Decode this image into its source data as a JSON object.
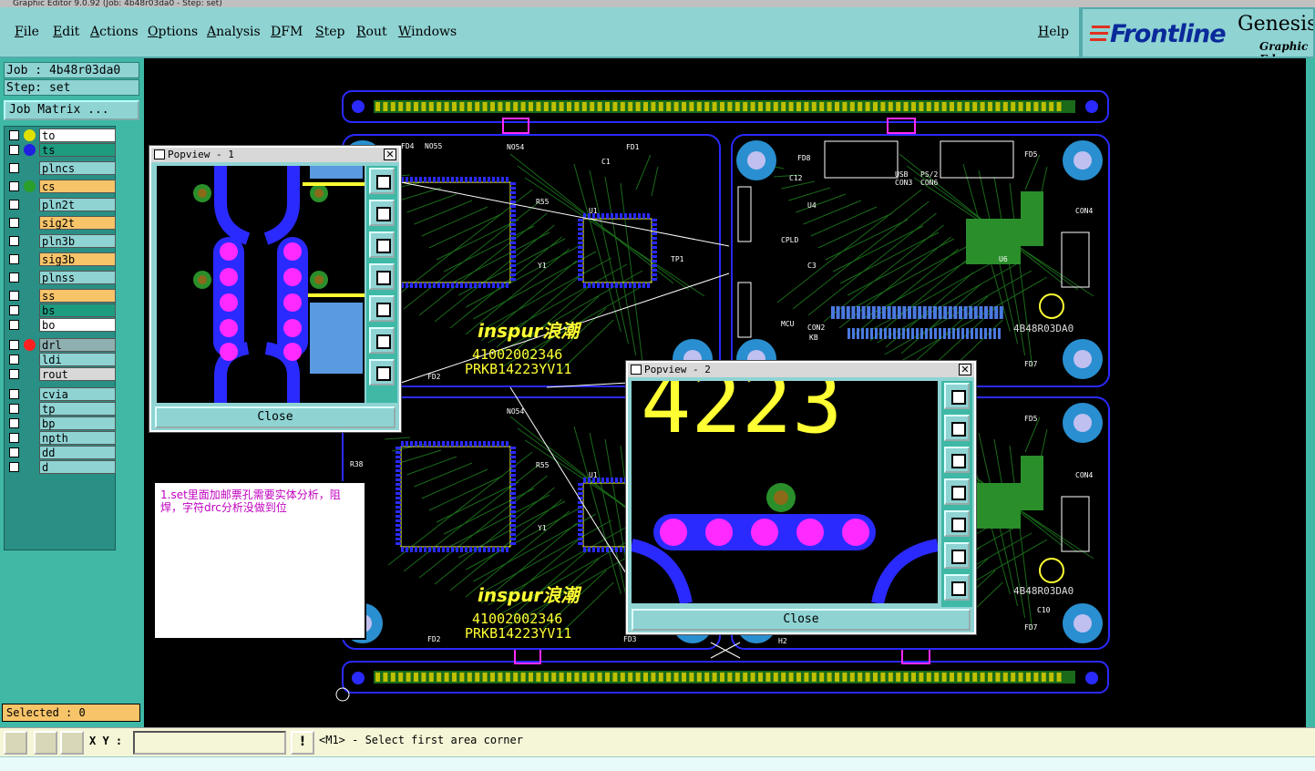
{
  "window": {
    "title": "Graphic Editor 9.0.92 (Job: 4b48r03da0 - Step: set)"
  },
  "menu": [
    "File",
    "Edit",
    "Actions",
    "Options",
    "Analysis",
    "DFM",
    "Step",
    "Rout",
    "Windows"
  ],
  "help": "Help",
  "logo": {
    "brand": "Frontline",
    "product": "Genesis",
    "subtitle": "Graphic Ed"
  },
  "job": {
    "label": "Job : 4b48r03da0",
    "step": "Step: set",
    "matrix_button": "Job Matrix ..."
  },
  "layers": [
    {
      "name": "to",
      "color": "#ffff00",
      "bg": "#ffffff",
      "dot": "#e0e000"
    },
    {
      "name": "ts",
      "color": "#1a1aff",
      "bg": "#1d9c80",
      "dot": "#2020e0"
    },
    {
      "name": "plncs",
      "bg": "#8fd3d3"
    },
    {
      "name": "cs",
      "bg": "#f7c46a",
      "dot": "#2aa02a"
    },
    {
      "name": "pln2t",
      "bg": "#8fd3d3"
    },
    {
      "name": "sig2t",
      "bg": "#f7c46a"
    },
    {
      "name": "pln3b",
      "bg": "#8fd3d3"
    },
    {
      "name": "sig3b",
      "bg": "#f7c46a"
    },
    {
      "name": "plnss",
      "bg": "#8fd3d3"
    },
    {
      "name": "ss",
      "bg": "#f7c46a"
    },
    {
      "name": "bs",
      "bg": "#1d9c80"
    },
    {
      "name": "bo",
      "bg": "#ffffff"
    },
    {
      "name": "drl",
      "bg": "#8fb0b0",
      "dot": "#ff2020"
    },
    {
      "name": "ldi",
      "bg": "#8fd3d3"
    },
    {
      "name": "rout",
      "bg": "#d8d8d8"
    },
    {
      "name": "cvia",
      "bg": "#8fd3d3"
    },
    {
      "name": "tp",
      "bg": "#8fd3d3"
    },
    {
      "name": "bp",
      "bg": "#8fd3d3"
    },
    {
      "name": "npth",
      "bg": "#8fd3d3"
    },
    {
      "name": "dd",
      "bg": "#8fd3d3"
    },
    {
      "name": "d",
      "bg": "#8fd3d3"
    }
  ],
  "selected": "Selected : 0",
  "status": {
    "xy_label": "X Y :",
    "message": "<M1> - Select first area corner"
  },
  "popup1": {
    "title": "Popview - 1",
    "close": "Close"
  },
  "popup2": {
    "title": "Popview - 2",
    "close": "Close",
    "zoom_text": "4223"
  },
  "note": "1.set里面加邮票孔需要实体分析，阻焊，字符drc分析没做到位",
  "board": {
    "brand": "inspur浪潮",
    "part": "41002002346",
    "rev": "PRKB14223YV11",
    "code": "4B48R03DA0",
    "labels": {
      "fd1": "FD1",
      "fd2": "FD2",
      "fd3": "FD3",
      "fd4": "FD4",
      "fd5": "FD5",
      "fd7": "FD7",
      "fd8": "FD8",
      "cpld": "CPLD",
      "con4": "CON4",
      "mcu": "MCU",
      "con2": "CON2",
      "kb": "KB",
      "tp1": "TP1",
      "u1": "U1",
      "y1": "Y1",
      "r55": "R55",
      "c1": "C1",
      "c12": "C12",
      "c3": "C3",
      "u4": "U4",
      "u6": "U6",
      "usb": "USB",
      "ps2": "PS/2",
      "con3": "CON3",
      "con6": "CON6",
      "r38": "R38",
      "no54": "NO54",
      "no55": "NO55",
      "h2": "H2",
      "c10": "C10"
    }
  },
  "colors": {
    "panel": "#3fb8a6",
    "menu": "#8fd3d3",
    "pad": "#2a2aff",
    "pad_pink": "#ff2aff",
    "silk": "#ffff33",
    "trace": "#1a6a1a",
    "cu": "#2a8f2a"
  }
}
